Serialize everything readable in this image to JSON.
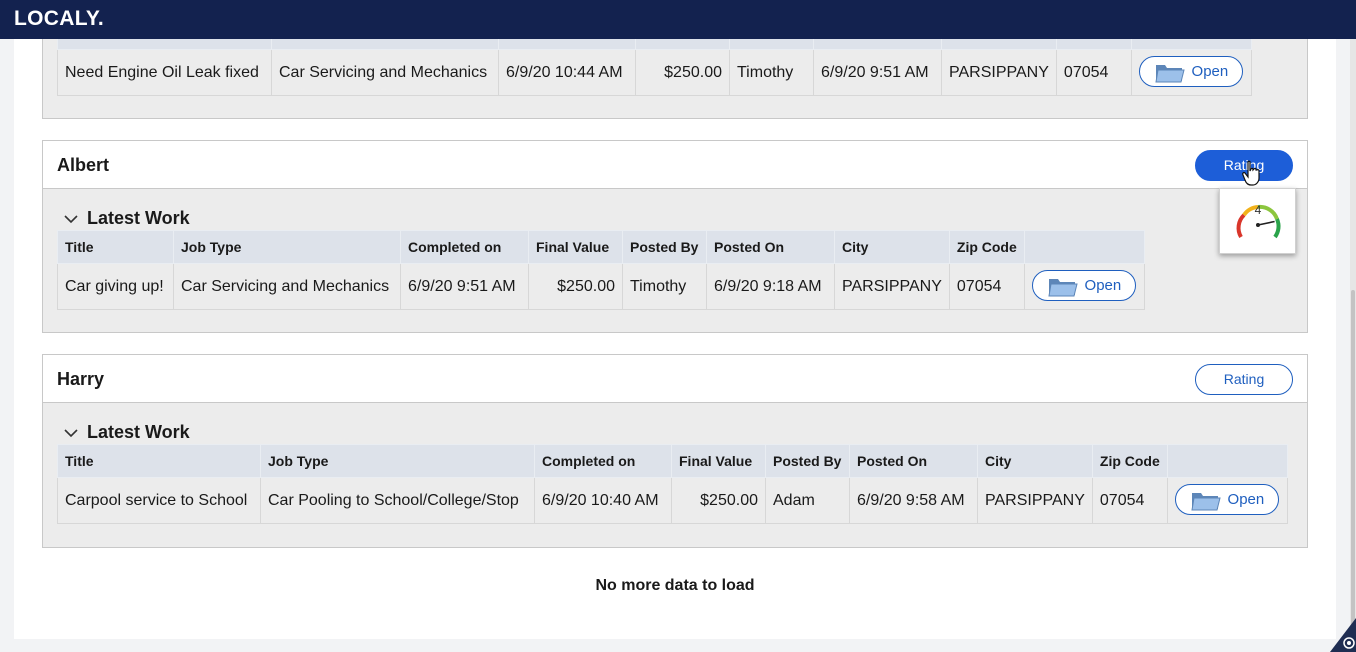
{
  "app": {
    "brand": "LOCALY."
  },
  "columns": [
    "Title",
    "Job Type",
    "Completed on",
    "Final Value",
    "Posted By",
    "Posted On",
    "City",
    "Zip Code"
  ],
  "top_card": {
    "row": {
      "title": "Need Engine Oil Leak fixed",
      "job_type": "Car Servicing and Mechanics",
      "completed_on": "6/9/20 10:44 AM",
      "final_value": "$250.00",
      "posted_by": "Timothy",
      "posted_on": "6/9/20 9:51 AM",
      "city": "PARSIPPANY",
      "zip": "07054",
      "open_label": "Open"
    }
  },
  "providers": [
    {
      "name": "Albert",
      "rating_label": "Rating",
      "section_title": "Latest Work",
      "row": {
        "title": "Car giving up!",
        "job_type": "Car Servicing and Mechanics",
        "completed_on": "6/9/20 9:51 AM",
        "final_value": "$250.00",
        "posted_by": "Timothy",
        "posted_on": "6/9/20 9:18 AM",
        "city": "PARSIPPANY",
        "zip": "07054",
        "open_label": "Open"
      }
    },
    {
      "name": "Harry",
      "rating_label": "Rating",
      "section_title": "Latest Work",
      "row": {
        "title": "Carpool service to School",
        "job_type": "Car Pooling to School/College/Stop",
        "completed_on": "6/9/20 10:40 AM",
        "final_value": "$250.00",
        "posted_by": "Adam",
        "posted_on": "6/9/20 9:58 AM",
        "city": "PARSIPPANY",
        "zip": "07054",
        "open_label": "Open"
      }
    }
  ],
  "rating_popover": {
    "value": "4",
    "max": 5,
    "level": 0.8,
    "icon": "gauge-icon"
  },
  "footer": {
    "message": "No more data to load"
  },
  "colors": {
    "topbar": "#13224f",
    "accent": "#1d5ed8",
    "link": "#1f5fbf",
    "header_cell": "#dde2ea",
    "row_bg": "#ececec"
  }
}
